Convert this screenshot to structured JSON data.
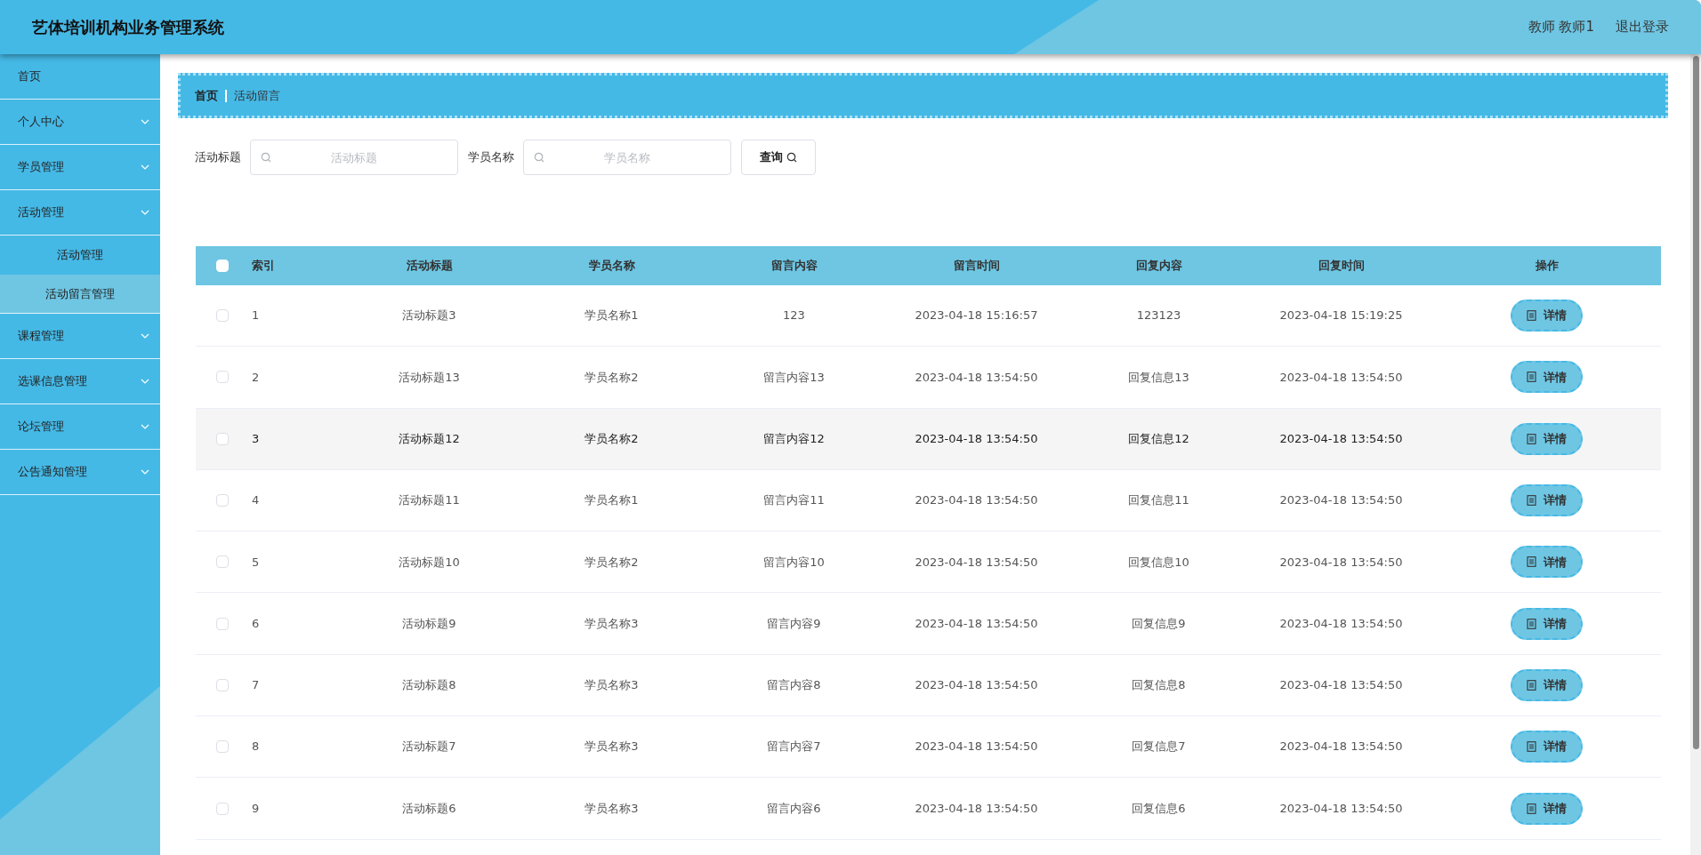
{
  "header": {
    "title": "艺体培训机构业务管理系统",
    "user": "教师 教师1",
    "logout": "退出登录"
  },
  "sidebar": {
    "items": [
      {
        "label": "首页",
        "has_children": false
      },
      {
        "label": "个人中心",
        "has_children": true
      },
      {
        "label": "学员管理",
        "has_children": true
      },
      {
        "label": "活动管理",
        "has_children": true,
        "children": [
          {
            "label": "活动管理",
            "selected": false
          },
          {
            "label": "活动留言管理",
            "selected": true
          }
        ]
      },
      {
        "label": "课程管理",
        "has_children": true
      },
      {
        "label": "选课信息管理",
        "has_children": true
      },
      {
        "label": "论坛管理",
        "has_children": true
      },
      {
        "label": "公告通知管理",
        "has_children": true
      }
    ]
  },
  "breadcrumb": [
    "首页",
    "活动留言"
  ],
  "search": {
    "fields": [
      {
        "label": "活动标题",
        "placeholder": "活动标题"
      },
      {
        "label": "学员名称",
        "placeholder": "学员名称"
      }
    ],
    "button": "查询"
  },
  "table": {
    "all_checked": false,
    "columns": [
      "索引",
      "活动标题",
      "学员名称",
      "留言内容",
      "留言时间",
      "回复内容",
      "回复时间",
      "操作"
    ],
    "rows": [
      {
        "checked": false,
        "highlighted": false,
        "cells": [
          "1",
          "活动标题3",
          "学员名称1",
          "123",
          "2023-04-18 15:16:57",
          "123123",
          "2023-04-18 15:19:25"
        ],
        "action": "详情"
      },
      {
        "checked": false,
        "highlighted": false,
        "cells": [
          "2",
          "活动标题13",
          "学员名称2",
          "留言内容13",
          "2023-04-18 13:54:50",
          "回复信息13",
          "2023-04-18 13:54:50"
        ],
        "action": "详情"
      },
      {
        "checked": false,
        "highlighted": true,
        "cells": [
          "3",
          "活动标题12",
          "学员名称2",
          "留言内容12",
          "2023-04-18 13:54:50",
          "回复信息12",
          "2023-04-18 13:54:50"
        ],
        "action": "详情"
      },
      {
        "checked": false,
        "highlighted": false,
        "cells": [
          "4",
          "活动标题11",
          "学员名称1",
          "留言内容11",
          "2023-04-18 13:54:50",
          "回复信息11",
          "2023-04-18 13:54:50"
        ],
        "action": "详情"
      },
      {
        "checked": false,
        "highlighted": false,
        "cells": [
          "5",
          "活动标题10",
          "学员名称2",
          "留言内容10",
          "2023-04-18 13:54:50",
          "回复信息10",
          "2023-04-18 13:54:50"
        ],
        "action": "详情"
      },
      {
        "checked": false,
        "highlighted": false,
        "cells": [
          "6",
          "活动标题9",
          "学员名称3",
          "留言内容9",
          "2023-04-18 13:54:50",
          "回复信息9",
          "2023-04-18 13:54:50"
        ],
        "action": "详情"
      },
      {
        "checked": false,
        "highlighted": false,
        "cells": [
          "7",
          "活动标题8",
          "学员名称3",
          "留言内容8",
          "2023-04-18 13:54:50",
          "回复信息8",
          "2023-04-18 13:54:50"
        ],
        "action": "详情"
      },
      {
        "checked": false,
        "highlighted": false,
        "cells": [
          "8",
          "活动标题7",
          "学员名称3",
          "留言内容7",
          "2023-04-18 13:54:50",
          "回复信息7",
          "2023-04-18 13:54:50"
        ],
        "action": "详情"
      },
      {
        "checked": false,
        "highlighted": false,
        "cells": [
          "9",
          "活动标题6",
          "学员名称3",
          "留言内容6",
          "2023-04-18 13:54:50",
          "回复信息6",
          "2023-04-18 13:54:50"
        ],
        "action": "详情"
      }
    ]
  }
}
